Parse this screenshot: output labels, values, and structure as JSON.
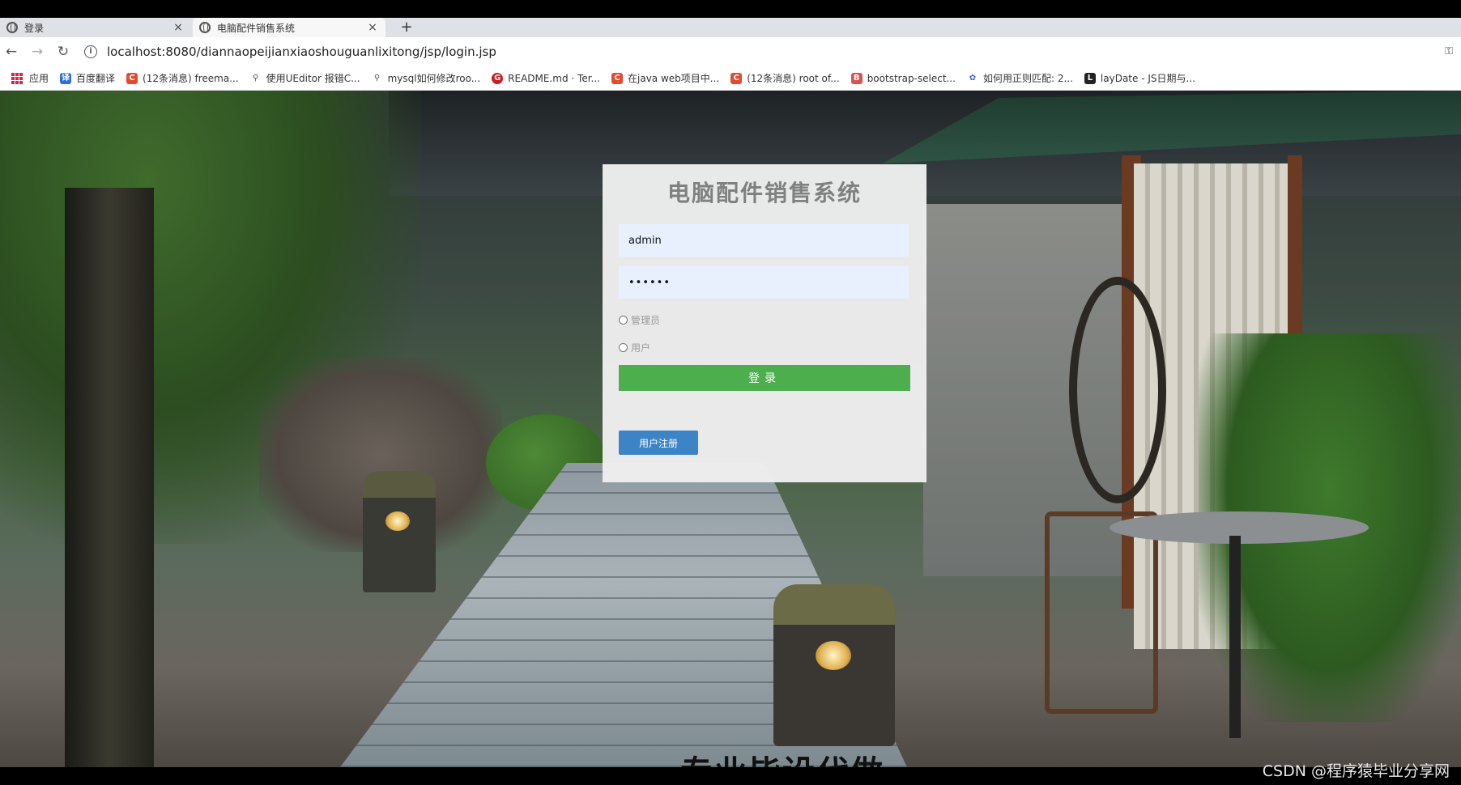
{
  "browser": {
    "tabs": [
      {
        "title": "登录",
        "close": "×"
      },
      {
        "title": "电脑配件销售系统",
        "close": "×"
      }
    ],
    "new_tab": "+",
    "nav": {
      "back": "←",
      "forward": "→",
      "reload": "↻"
    },
    "url": "localhost:8080/diannaopeijianxiaoshouguanlixitong/jsp/login.jsp",
    "bookmarks": [
      {
        "label": "应用",
        "icon": "apps-grid-icon"
      },
      {
        "label": "百度翻译",
        "icon": "translate-icon",
        "color": "#2d6fd8",
        "glyph": "译"
      },
      {
        "label": "(12条消息) freema...",
        "icon": "csdn-icon",
        "color": "#e24b2f",
        "glyph": "C"
      },
      {
        "label": "使用UEditor 报错C...",
        "icon": "ueditor-icon",
        "color": "#555555",
        "glyph": "⚲"
      },
      {
        "label": "mysql如何修改roo...",
        "icon": "mysql-icon",
        "color": "#555555",
        "glyph": "⚲"
      },
      {
        "label": "README.md · Ter...",
        "icon": "gitee-icon",
        "color": "#c71d23",
        "glyph": "G"
      },
      {
        "label": "在java web项目中...",
        "icon": "csdn-icon",
        "color": "#e24b2f",
        "glyph": "C"
      },
      {
        "label": "(12条消息) root of...",
        "icon": "csdn-icon",
        "color": "#e24b2f",
        "glyph": "C"
      },
      {
        "label": "bootstrap-select...",
        "icon": "bookmark-icon",
        "color": "#d9534f",
        "glyph": "B"
      },
      {
        "label": "如何用正则匹配: 2...",
        "icon": "baidu-icon",
        "color": "#3c5fd6",
        "glyph": "✿"
      },
      {
        "label": "layDate - JS日期与...",
        "icon": "laydate-icon",
        "color": "#222222",
        "glyph": "L"
      }
    ]
  },
  "login": {
    "title": "电脑配件销售系统",
    "username": "admin",
    "password_mask": "••••••",
    "roles": [
      "管理员",
      "用户"
    ],
    "login_button": "登录",
    "register_button": "用户注册"
  },
  "video_subtitle": "专业毕设代做",
  "watermark": "CSDN @程序猿毕业分享网",
  "colors": {
    "login_button": "#4cae4c",
    "register_button": "#3d84c6",
    "field_bg": "#e8f0fe",
    "title": "#808080"
  }
}
